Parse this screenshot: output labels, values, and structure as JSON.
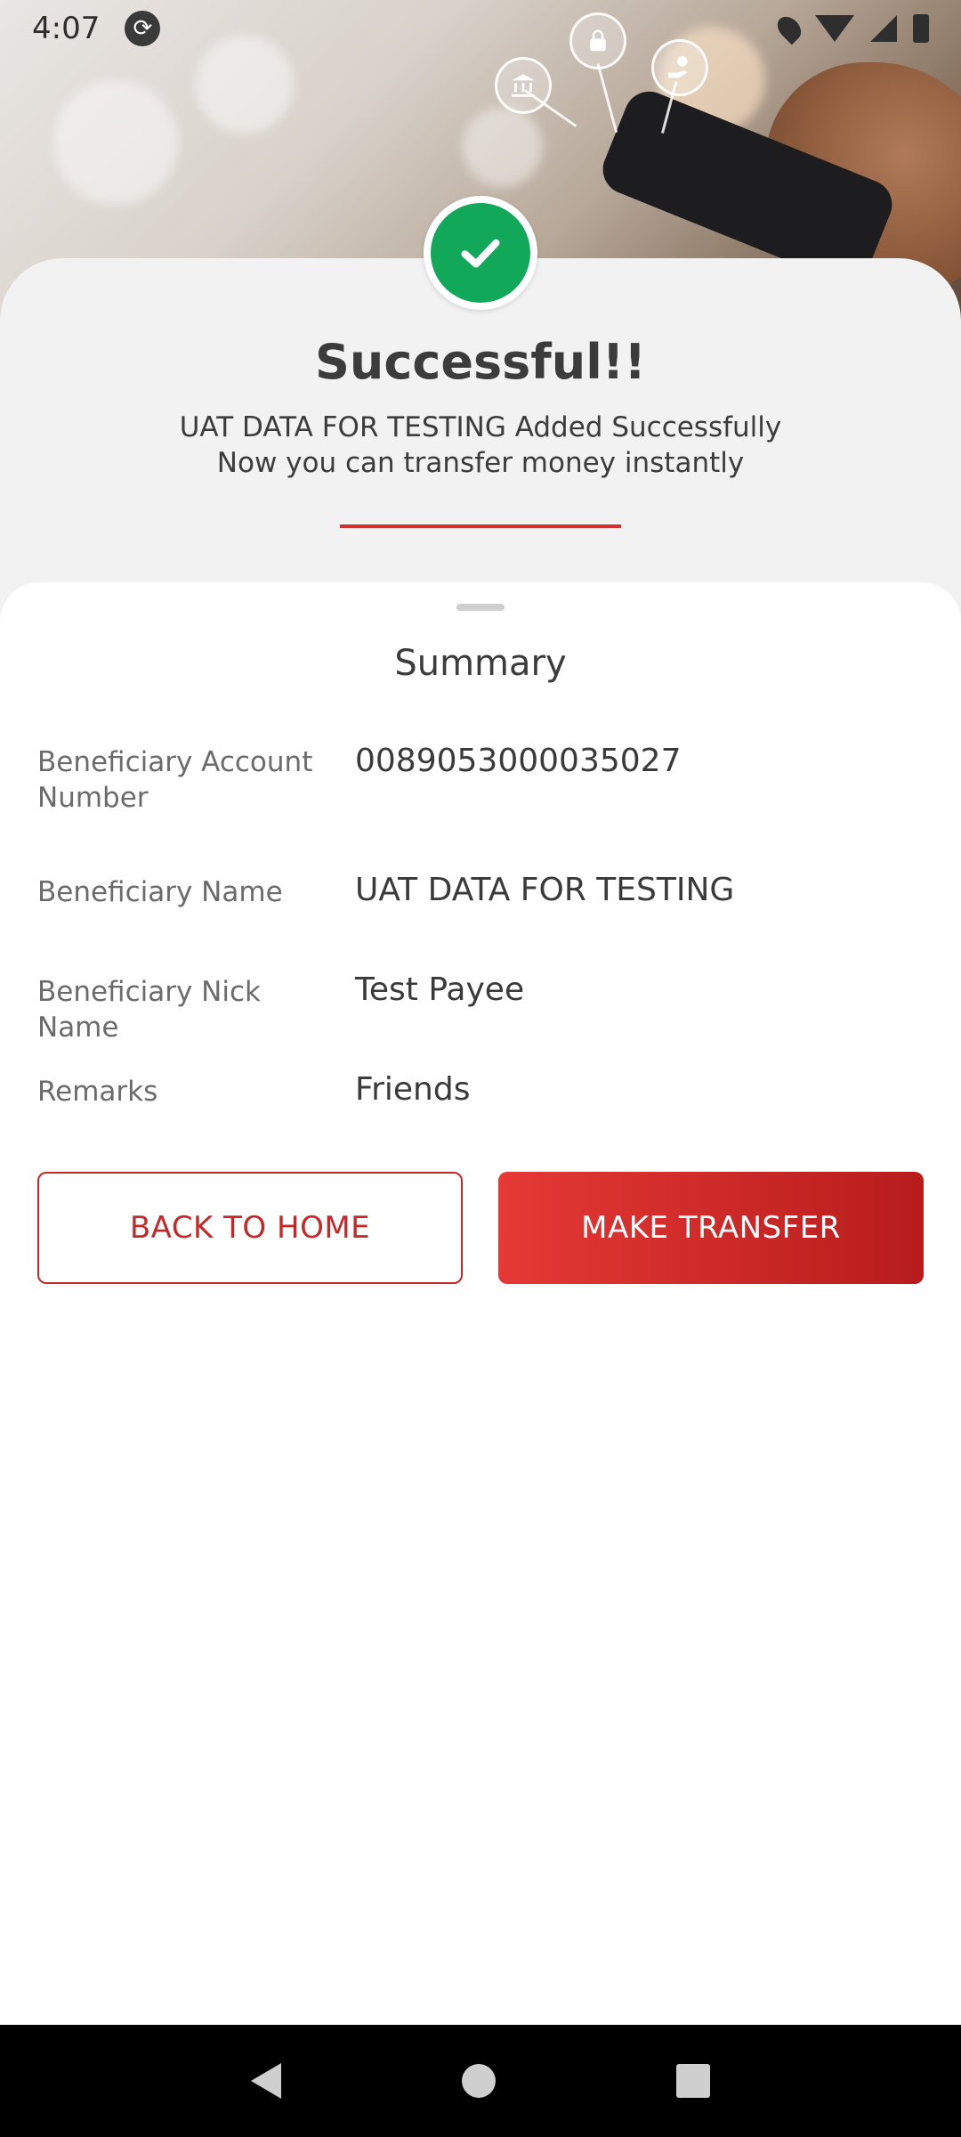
{
  "status_bar": {
    "time": "4:07"
  },
  "success": {
    "title": "Successful!!",
    "line1": "UAT DATA FOR TESTING Added Successfully",
    "line2": "Now you can transfer money instantly"
  },
  "summary": {
    "title": "Summary",
    "rows": [
      {
        "label": "Beneficiary Account Number",
        "value": "0089053000035027"
      },
      {
        "label": "Beneficiary Name",
        "value": "UAT DATA FOR TESTING"
      },
      {
        "label": "Beneficiary Nick Name",
        "value": "Test Payee"
      },
      {
        "label": "Remarks",
        "value": "Friends"
      }
    ]
  },
  "actions": {
    "back_label": "BACK TO HOME",
    "transfer_label": "MAKE TRANSFER"
  },
  "colors": {
    "accent": "#c62828",
    "success": "#12a85a"
  },
  "icons": {
    "check": "check-circle-icon",
    "bank": "bank-icon",
    "lock": "lock-icon",
    "hand_coin": "hand-coin-icon"
  }
}
